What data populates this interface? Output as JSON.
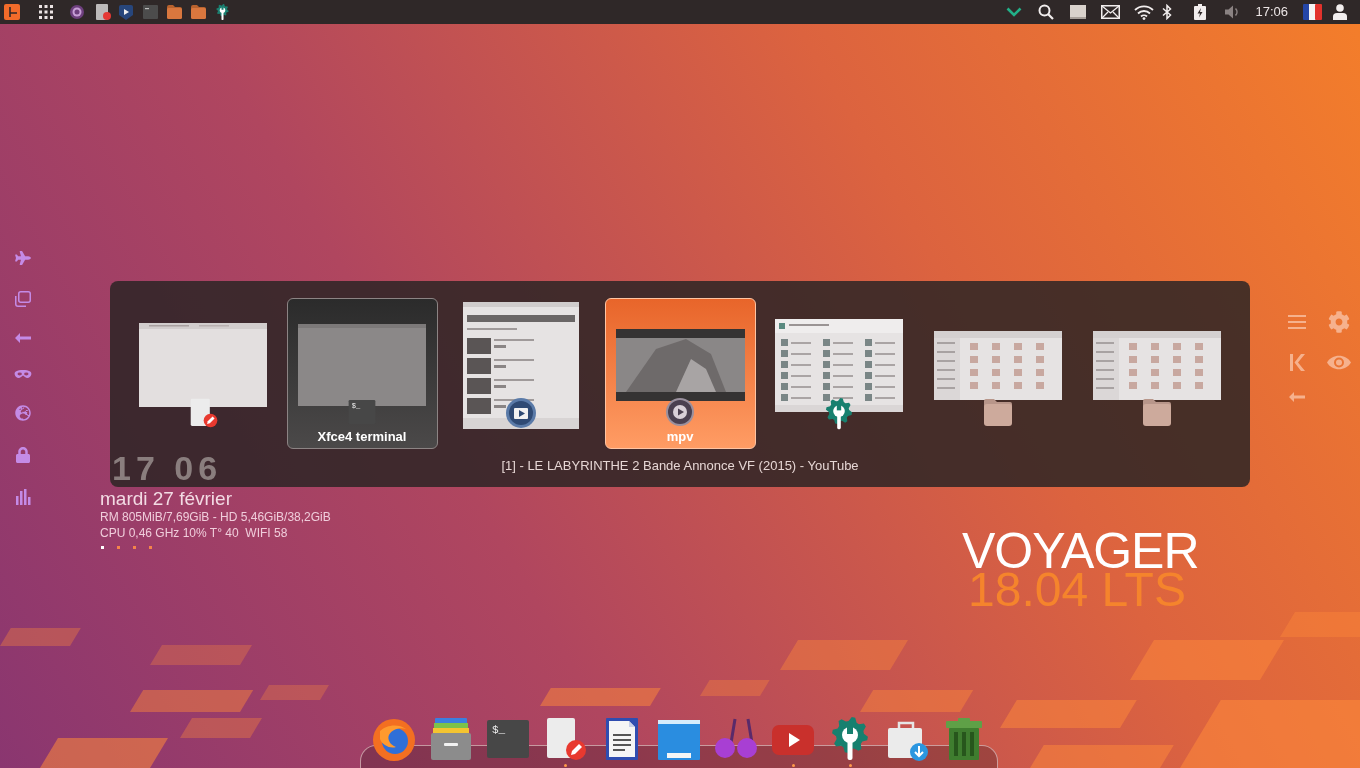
{
  "top_bar": {
    "clock": "17:06"
  },
  "conky": {
    "time": "17 06",
    "date": "mardi 27 février",
    "stats": [
      "RM 805MiB/7,69GiB - HD 5,46GiB/38,2GiB",
      "CPU 0,46 GHz 10% T° 40  WIFI 58"
    ],
    "pages": [
      {
        "selected": true
      },
      {
        "selected": false
      },
      {
        "selected": false
      },
      {
        "selected": false
      }
    ]
  },
  "switcher": {
    "windows": [
      {
        "kind": "editor",
        "selected": false,
        "hovered": false
      },
      {
        "kind": "terminal",
        "selected": false,
        "hovered": true,
        "label": "Xfce4 terminal",
        "glyph": "$_"
      },
      {
        "kind": "browser",
        "selected": false,
        "hovered": false
      },
      {
        "kind": "video",
        "selected": true,
        "hovered": false,
        "label": "mpv"
      },
      {
        "kind": "settings",
        "selected": false,
        "hovered": false
      },
      {
        "kind": "files",
        "selected": false,
        "hovered": false
      },
      {
        "kind": "files",
        "selected": false,
        "hovered": false
      }
    ],
    "caption": "[1] - LE LABYRINTHE 2 Bande Annonce VF (2015) - YouTube"
  },
  "branding": {
    "name": "VOYAGER",
    "version": "18.04 LTS"
  },
  "dock": {
    "items": [
      {
        "kind": "browser",
        "running": false
      },
      {
        "kind": "cabinet",
        "running": false
      },
      {
        "kind": "terminal",
        "running": false,
        "glyph": "$_"
      },
      {
        "kind": "editor",
        "running": true
      },
      {
        "kind": "writer",
        "running": false
      },
      {
        "kind": "window",
        "running": false
      },
      {
        "kind": "music",
        "running": false
      },
      {
        "kind": "video",
        "running": true
      },
      {
        "kind": "settings",
        "running": true
      },
      {
        "kind": "package",
        "running": false
      },
      {
        "kind": "trash",
        "running": false
      }
    ]
  }
}
